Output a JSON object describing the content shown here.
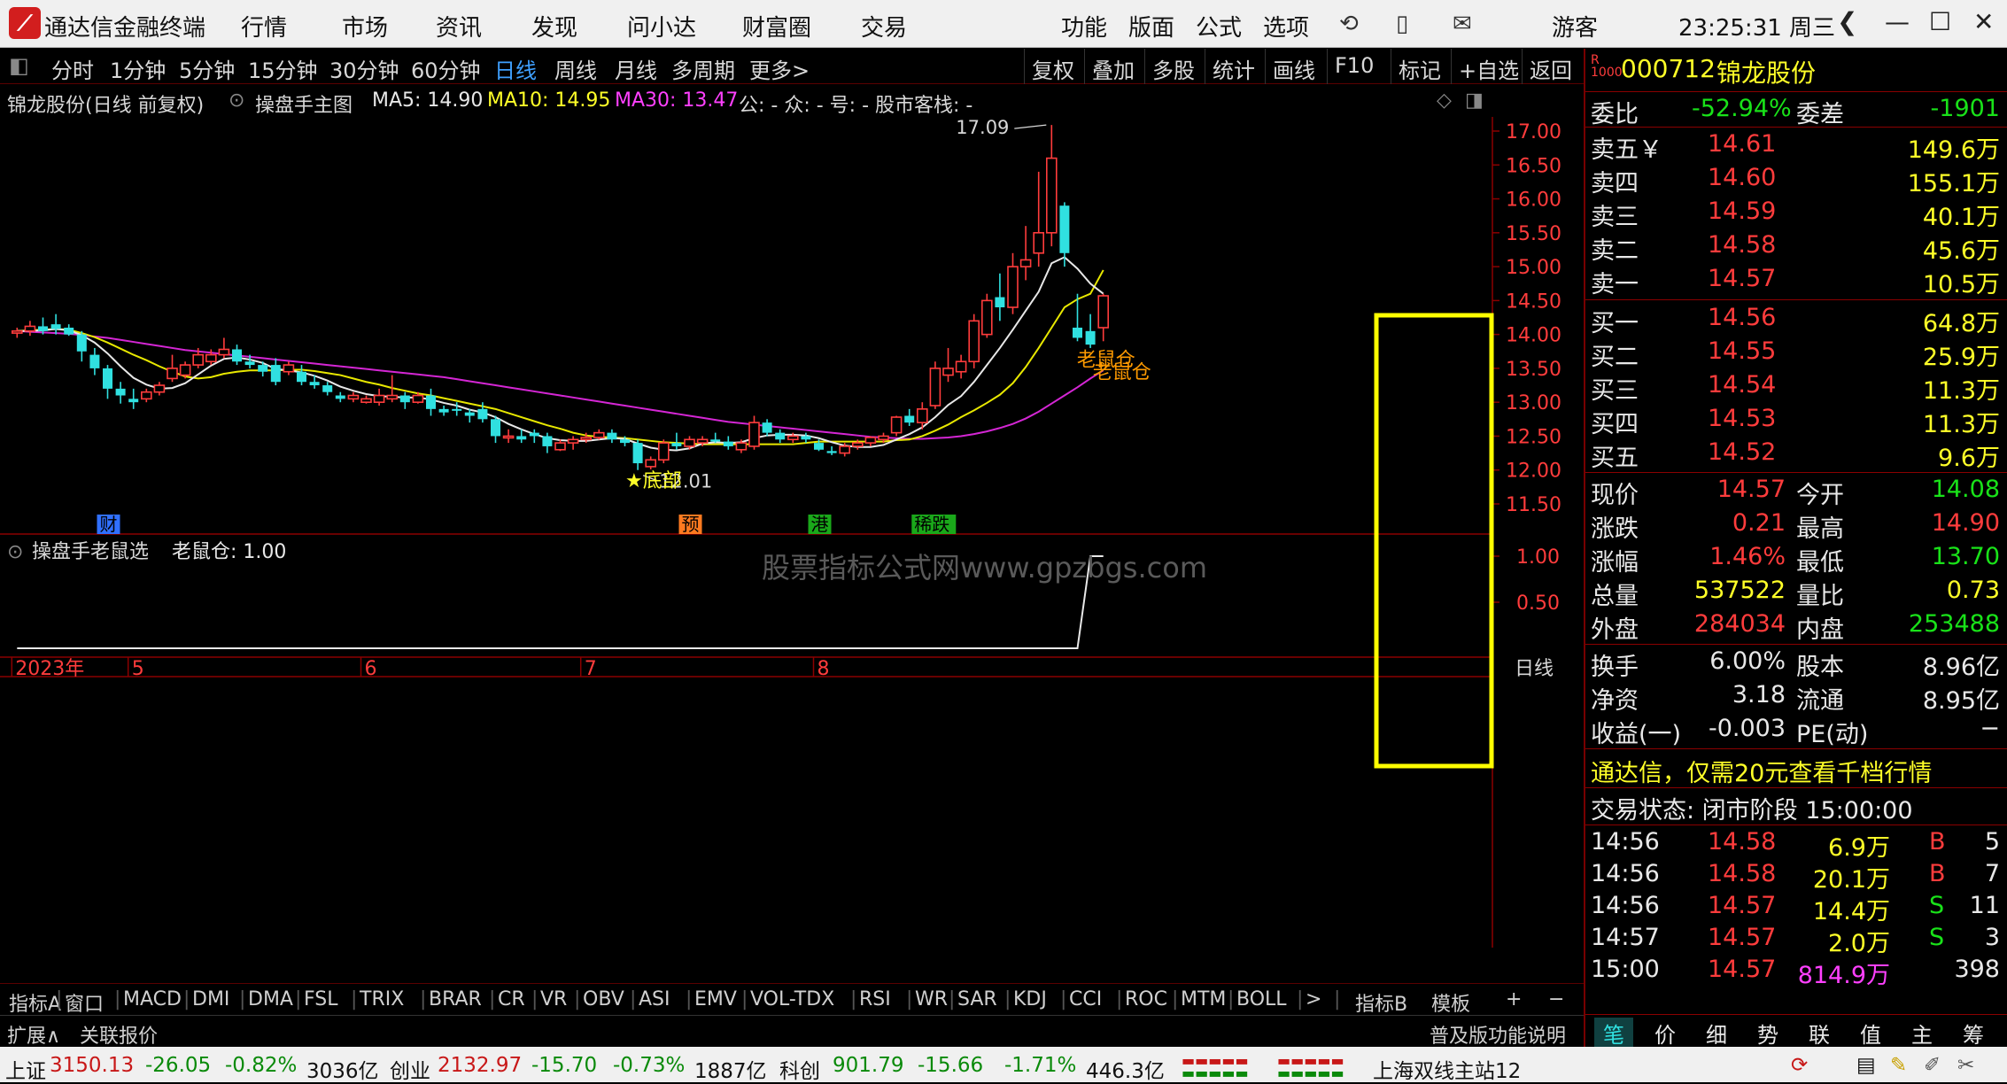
{
  "titlebar": {
    "app_name": "通达信金融终端",
    "menu": [
      "行情",
      "市场",
      "资讯",
      "发现",
      "问小达",
      "财富圈",
      "交易"
    ],
    "menu2": [
      "功能",
      "版面",
      "公式",
      "选项"
    ],
    "user": "游客",
    "clock": "23:25:31 周三"
  },
  "toolbar": {
    "periods": [
      "分时",
      "1分钟",
      "5分钟",
      "15分钟",
      "30分钟",
      "60分钟",
      "日线",
      "周线",
      "月线",
      "多周期",
      "更多>"
    ],
    "active": "日线",
    "right_buttons": [
      "复权",
      "叠加",
      "多股",
      "统计",
      "画线",
      "F10",
      "标记",
      "+自选",
      "返回"
    ]
  },
  "infobar": {
    "stock_title": "锦龙股份(日线 前复权)",
    "main_chart": "操盘手主图",
    "ma5": "MA5: 14.90",
    "ma10": "MA10: 14.95",
    "ma30": "MA30: 13.47",
    "extra": "公: -  众: -  号: -  股市客栈: -"
  },
  "chart_data": {
    "type": "candlestick",
    "y_ticks": [
      "17.00",
      "16.50",
      "16.00",
      "15.50",
      "15.00",
      "14.50",
      "14.00",
      "13.50",
      "13.00",
      "12.50",
      "12.00",
      "11.50"
    ],
    "ylim": [
      11.3,
      17.2
    ],
    "annotations": {
      "high_label": "17.09",
      "low_label": "12.01",
      "bottom_marker": "★底部",
      "signal_label": "老鼠仓",
      "watermark": "股票指标公式网www.gpzbgs.com"
    },
    "event_tags": [
      {
        "label": "财",
        "color": "#3070ff",
        "bar": 7
      },
      {
        "label": "预",
        "color": "#ff7a20",
        "bar": 52
      },
      {
        "label": "港",
        "color": "#1aa81a",
        "bar": 62
      },
      {
        "label": "稀跌",
        "color": "#1aa81a",
        "bar": 70
      }
    ],
    "x_labels": [
      {
        "label": "2023年",
        "bar": 0
      },
      {
        "label": "5",
        "bar": 9
      },
      {
        "label": "6",
        "bar": 27
      },
      {
        "label": "7",
        "bar": 44
      },
      {
        "label": "8",
        "bar": 62
      }
    ],
    "period_label": "日线",
    "indicator": {
      "name": "操盘手老鼠选",
      "series_label": "老鼠仓: 1.00",
      "y_ticks": [
        "1.00",
        "0.50"
      ],
      "values_last": [
        0,
        0,
        1,
        1
      ]
    },
    "candles": [
      [
        14.02,
        14.1,
        13.95,
        14.05
      ],
      [
        14.05,
        14.2,
        13.98,
        14.12
      ],
      [
        14.12,
        14.25,
        14.0,
        14.05
      ],
      [
        14.15,
        14.3,
        14.0,
        14.08
      ],
      [
        14.1,
        14.15,
        13.98,
        14.0
      ],
      [
        14.0,
        14.05,
        13.6,
        13.75
      ],
      [
        13.7,
        13.8,
        13.4,
        13.5
      ],
      [
        13.5,
        13.55,
        13.05,
        13.2
      ],
      [
        13.2,
        13.3,
        12.98,
        13.1
      ],
      [
        13.05,
        13.2,
        12.9,
        13.0
      ],
      [
        13.05,
        13.2,
        13.0,
        13.15
      ],
      [
        13.15,
        13.3,
        13.1,
        13.25
      ],
      [
        13.35,
        13.7,
        13.3,
        13.5
      ],
      [
        13.4,
        13.6,
        13.35,
        13.55
      ],
      [
        13.55,
        13.8,
        13.5,
        13.7
      ],
      [
        13.6,
        13.78,
        13.55,
        13.7
      ],
      [
        13.7,
        13.95,
        13.65,
        13.78
      ],
      [
        13.78,
        13.85,
        13.55,
        13.6
      ],
      [
        13.6,
        13.7,
        13.5,
        13.55
      ],
      [
        13.55,
        13.6,
        13.38,
        13.45
      ],
      [
        13.55,
        13.65,
        13.25,
        13.3
      ],
      [
        13.45,
        13.6,
        13.4,
        13.55
      ],
      [
        13.45,
        13.55,
        13.25,
        13.3
      ],
      [
        13.3,
        13.4,
        13.2,
        13.25
      ],
      [
        13.25,
        13.3,
        13.1,
        13.15
      ],
      [
        13.1,
        13.15,
        13.0,
        13.05
      ],
      [
        13.05,
        13.15,
        13.0,
        13.1
      ],
      [
        13.0,
        13.1,
        12.98,
        13.05
      ],
      [
        13.0,
        13.2,
        12.95,
        13.1
      ],
      [
        13.05,
        13.4,
        13.0,
        13.1
      ],
      [
        13.1,
        13.15,
        12.9,
        13.0
      ],
      [
        13.0,
        13.15,
        12.98,
        13.1
      ],
      [
        13.1,
        13.2,
        12.8,
        12.9
      ],
      [
        12.9,
        12.95,
        12.8,
        12.85
      ],
      [
        12.9,
        13.0,
        12.8,
        12.88
      ],
      [
        12.85,
        12.9,
        12.7,
        12.8
      ],
      [
        12.9,
        13.0,
        12.7,
        12.75
      ],
      [
        12.75,
        12.8,
        12.4,
        12.5
      ],
      [
        12.5,
        12.6,
        12.4,
        12.5
      ],
      [
        12.5,
        12.6,
        12.4,
        12.45
      ],
      [
        12.55,
        12.6,
        12.4,
        12.5
      ],
      [
        12.5,
        12.55,
        12.25,
        12.35
      ],
      [
        12.3,
        12.45,
        12.28,
        12.4
      ],
      [
        12.4,
        12.5,
        12.3,
        12.45
      ],
      [
        12.45,
        12.55,
        12.4,
        12.48
      ],
      [
        12.48,
        12.6,
        12.45,
        12.55
      ],
      [
        12.55,
        12.6,
        12.4,
        12.45
      ],
      [
        12.45,
        12.5,
        12.35,
        12.4
      ],
      [
        12.4,
        12.45,
        12.0,
        12.1
      ],
      [
        12.05,
        12.2,
        12.01,
        12.15
      ],
      [
        12.15,
        12.45,
        12.1,
        12.4
      ],
      [
        12.4,
        12.55,
        12.3,
        12.35
      ],
      [
        12.35,
        12.5,
        12.3,
        12.45
      ],
      [
        12.4,
        12.5,
        12.35,
        12.45
      ],
      [
        12.45,
        12.55,
        12.4,
        12.42
      ],
      [
        12.42,
        12.5,
        12.3,
        12.35
      ],
      [
        12.3,
        12.45,
        12.25,
        12.4
      ],
      [
        12.35,
        12.8,
        12.3,
        12.7
      ],
      [
        12.7,
        12.75,
        12.5,
        12.55
      ],
      [
        12.55,
        12.6,
        12.4,
        12.45
      ],
      [
        12.45,
        12.55,
        12.4,
        12.5
      ],
      [
        12.5,
        12.55,
        12.4,
        12.45
      ],
      [
        12.4,
        12.45,
        12.28,
        12.3
      ],
      [
        12.28,
        12.35,
        12.22,
        12.25
      ],
      [
        12.25,
        12.4,
        12.2,
        12.35
      ],
      [
        12.35,
        12.45,
        12.3,
        12.4
      ],
      [
        12.4,
        12.5,
        12.35,
        12.48
      ],
      [
        12.45,
        12.55,
        12.4,
        12.5
      ],
      [
        12.55,
        12.8,
        12.5,
        12.78
      ],
      [
        12.8,
        12.9,
        12.65,
        12.7
      ],
      [
        12.7,
        13.0,
        12.6,
        12.9
      ],
      [
        12.95,
        13.6,
        12.9,
        13.5
      ],
      [
        13.4,
        13.8,
        13.3,
        13.5
      ],
      [
        13.45,
        13.7,
        13.35,
        13.6
      ],
      [
        13.6,
        14.3,
        13.5,
        14.2
      ],
      [
        14.0,
        14.6,
        13.95,
        14.5
      ],
      [
        14.55,
        14.9,
        14.2,
        14.4
      ],
      [
        14.4,
        15.2,
        14.3,
        15.0
      ],
      [
        15.0,
        15.6,
        14.8,
        15.1
      ],
      [
        15.2,
        16.4,
        15.0,
        15.5
      ],
      [
        15.5,
        17.09,
        15.3,
        16.6
      ],
      [
        15.9,
        15.95,
        15.0,
        15.2
      ],
      [
        14.1,
        14.6,
        13.9,
        13.95
      ],
      [
        14.05,
        14.3,
        13.8,
        13.85
      ],
      [
        14.1,
        14.6,
        13.9,
        14.57
      ]
    ],
    "ma5": [
      14.05,
      14.05,
      14.06,
      14.08,
      14.06,
      13.99,
      13.88,
      13.72,
      13.53,
      13.36,
      13.26,
      13.2,
      13.21,
      13.28,
      13.41,
      13.54,
      13.64,
      13.66,
      13.63,
      13.58,
      13.49,
      13.47,
      13.44,
      13.39,
      13.32,
      13.23,
      13.17,
      13.12,
      13.09,
      13.08,
      13.07,
      13.07,
      13.04,
      12.99,
      12.95,
      12.89,
      12.85,
      12.78,
      12.68,
      12.6,
      12.53,
      12.47,
      12.44,
      12.43,
      12.43,
      12.45,
      12.47,
      12.46,
      12.39,
      12.33,
      12.3,
      12.29,
      12.32,
      12.39,
      12.41,
      12.4,
      12.41,
      12.47,
      12.51,
      12.52,
      12.52,
      12.51,
      12.47,
      12.41,
      12.36,
      12.34,
      12.34,
      12.37,
      12.45,
      12.53,
      12.63,
      12.78,
      12.96,
      13.09,
      13.3,
      13.55,
      13.8,
      14.07,
      14.35,
      14.63,
      15.05,
      15.14,
      14.97,
      14.75,
      14.6
    ],
    "ma10": [
      14.05,
      14.06,
      14.07,
      14.08,
      14.07,
      14.02,
      13.96,
      13.88,
      13.79,
      13.7,
      13.62,
      13.53,
      13.45,
      13.38,
      13.35,
      13.37,
      13.42,
      13.45,
      13.47,
      13.47,
      13.47,
      13.48,
      13.48,
      13.46,
      13.43,
      13.4,
      13.35,
      13.3,
      13.26,
      13.21,
      13.17,
      13.13,
      13.1,
      13.06,
      13.02,
      12.98,
      12.94,
      12.9,
      12.84,
      12.78,
      12.72,
      12.66,
      12.61,
      12.55,
      12.51,
      12.49,
      12.48,
      12.47,
      12.45,
      12.43,
      12.41,
      12.4,
      12.39,
      12.38,
      12.38,
      12.38,
      12.38,
      12.38,
      12.38,
      12.38,
      12.38,
      12.4,
      12.42,
      12.42,
      12.42,
      12.42,
      12.42,
      12.42,
      12.44,
      12.45,
      12.5,
      12.58,
      12.67,
      12.78,
      12.88,
      12.99,
      13.11,
      13.28,
      13.52,
      13.8,
      14.1,
      14.4,
      14.52,
      14.6,
      14.95
    ],
    "ma30": [
      14.05,
      14.04,
      14.03,
      14.02,
      14.01,
      13.99,
      13.97,
      13.95,
      13.92,
      13.89,
      13.86,
      13.83,
      13.8,
      13.77,
      13.75,
      13.73,
      13.71,
      13.69,
      13.67,
      13.65,
      13.63,
      13.61,
      13.59,
      13.57,
      13.55,
      13.53,
      13.51,
      13.49,
      13.47,
      13.45,
      13.43,
      13.41,
      13.39,
      13.37,
      13.34,
      13.31,
      13.28,
      13.25,
      13.22,
      13.19,
      13.16,
      13.13,
      13.1,
      13.07,
      13.04,
      13.01,
      12.98,
      12.95,
      12.92,
      12.89,
      12.86,
      12.83,
      12.8,
      12.77,
      12.74,
      12.71,
      12.69,
      12.67,
      12.65,
      12.63,
      12.61,
      12.59,
      12.57,
      12.55,
      12.53,
      12.51,
      12.49,
      12.48,
      12.47,
      12.46,
      12.46,
      12.47,
      12.48,
      12.5,
      12.53,
      12.57,
      12.62,
      12.68,
      12.76,
      12.86,
      12.98,
      13.1,
      13.22,
      13.35,
      13.47
    ]
  },
  "bottomtabs": {
    "items": [
      "指标A",
      "窗口",
      "MACD",
      "DMI",
      "DMA",
      "FSL",
      "TRIX",
      "BRAR",
      "CR",
      "VR",
      "OBV",
      "ASI",
      "EMV",
      "VOL-TDX",
      "RSI",
      "WR",
      "SAR",
      "KDJ",
      "CCI",
      "ROC",
      "MTM",
      "BOLL",
      ">"
    ],
    "right": [
      "指标B",
      "模板",
      "+",
      "−"
    ]
  },
  "bottombar2": {
    "left": "扩展∧",
    "left2": "关联报价",
    "right": "普及版功能说明"
  },
  "rightpanel": {
    "code": "000712",
    "name": "锦龙股份",
    "weibi_label": "委比",
    "weibi": "-52.94%",
    "weicha_label": "委差",
    "weicha": "-1901",
    "sell": [
      {
        "l": "卖五￥",
        "p": "14.61",
        "v": "149.6万"
      },
      {
        "l": "卖四",
        "p": "14.60",
        "v": "155.1万"
      },
      {
        "l": "卖三",
        "p": "14.59",
        "v": "40.1万"
      },
      {
        "l": "卖二",
        "p": "14.58",
        "v": "45.6万"
      },
      {
        "l": "卖一",
        "p": "14.57",
        "v": "10.5万"
      }
    ],
    "buy": [
      {
        "l": "买一",
        "p": "14.56",
        "v": "64.8万"
      },
      {
        "l": "买二",
        "p": "14.55",
        "v": "25.9万"
      },
      {
        "l": "买三",
        "p": "14.54",
        "v": "11.3万"
      },
      {
        "l": "买四",
        "p": "14.53",
        "v": "11.3万"
      },
      {
        "l": "买五",
        "p": "14.52",
        "v": "9.6万"
      }
    ],
    "stats": [
      {
        "l1": "现价",
        "v1": "14.57",
        "c1": "red",
        "l2": "今开",
        "v2": "14.08",
        "c2": "green"
      },
      {
        "l1": "涨跌",
        "v1": "0.21",
        "c1": "red",
        "l2": "最高",
        "v2": "14.90",
        "c2": "red"
      },
      {
        "l1": "涨幅",
        "v1": "1.46%",
        "c1": "red",
        "l2": "最低",
        "v2": "13.70",
        "c2": "green"
      },
      {
        "l1": "总量",
        "v1": "537522",
        "c1": "yellow",
        "l2": "量比",
        "v2": "0.73",
        "c2": "yellow"
      },
      {
        "l1": "外盘",
        "v1": "284034",
        "c1": "red",
        "l2": "内盘",
        "v2": "253488",
        "c2": "green"
      }
    ],
    "stats2": [
      {
        "l1": "换手",
        "v1": "6.00%",
        "l2": "股本",
        "v2": "8.96亿"
      },
      {
        "l1": "净资",
        "v1": "3.18",
        "l2": "流通",
        "v2": "8.95亿"
      },
      {
        "l1": "收益(一)",
        "v1": "-0.003",
        "l2": "PE(动)",
        "v2": "−"
      }
    ],
    "ad": "通达信，仅需20元查看千档行情",
    "trade_state": "交易状态: 闭市阶段 15:00:00",
    "ticks": [
      {
        "t": "14:56",
        "p": "14.58",
        "v": "6.9万",
        "s": "B",
        "n": "5"
      },
      {
        "t": "14:56",
        "p": "14.58",
        "v": "20.1万",
        "s": "B",
        "n": "7"
      },
      {
        "t": "14:56",
        "p": "14.57",
        "v": "14.4万",
        "s": "S",
        "n": "11"
      },
      {
        "t": "14:57",
        "p": "14.57",
        "v": "2.0万",
        "s": "S",
        "n": "3"
      },
      {
        "t": "15:00",
        "p": "14.57",
        "v": "814.9万",
        "s": "",
        "n": "398"
      }
    ],
    "tabs": [
      "笔",
      "价",
      "细",
      "势",
      "联",
      "值",
      "主",
      "筹"
    ]
  },
  "statusbar": {
    "sh_name": "上证",
    "sh_val": "3150.13",
    "sh_chg": "-26.05",
    "sh_pct": "-0.82%",
    "sh_amt": "3036亿",
    "cy_name": "创业",
    "cy_val": "2132.97",
    "cy_chg": "-15.70",
    "cy_pct": "-0.73%",
    "cy_amt": "1887亿",
    "kc_name": "科创",
    "kc_val": "901.79",
    "kc_chg": "-15.66",
    "kc_pct": "-1.71%",
    "kc_amt": "446.3亿",
    "server": "上海双线主站12"
  }
}
